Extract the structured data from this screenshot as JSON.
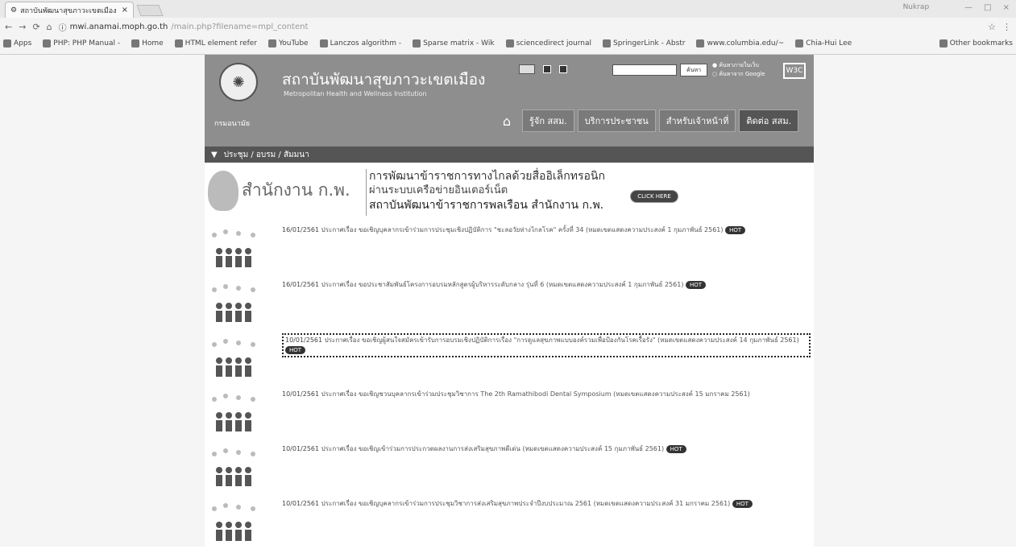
{
  "browser": {
    "tab_title": "สถาบันพัฒนาสุขภาวะเขตเมือง",
    "tab_close": "×",
    "user_label": "Nukrap",
    "window_controls": [
      "—",
      "□",
      "×"
    ],
    "url_host": "mwi.anamai.moph.go.th",
    "url_path": "/main.php?filename=mpl_content",
    "bookmarks": [
      "Apps",
      "PHP: PHP Manual -",
      "Home",
      "HTML element refer",
      "YouTube",
      "Lanczos algorithm -",
      "Sparse matrix - Wik",
      "sciencedirect journal",
      "SpringerLink - Abstr",
      "www.columbia.edu/~",
      "Chia-Hui Lee"
    ],
    "other_bookmarks": "Other bookmarks"
  },
  "site": {
    "title": "สถาบันพัฒนาสุขภาวะเขตเมือง",
    "subtitle": "Metropolitan Health and Wellness Institution",
    "dept": "กรมอนามัย",
    "search_button": "ค้นหา",
    "radio1": "ค้นหาภายในเว็บ",
    "radio2": "ค้นหาจาก Google",
    "w3c": "W3C",
    "nav": [
      "รู้จัก สสม.",
      "บริการประชาชน",
      "สำหรับเจ้าหน้าที่",
      "ติดต่อ สสม."
    ],
    "breadcrumb": "ประชุม / อบรม / สัมมนา",
    "banner_org": "สำนักงาน ก.พ.",
    "banner_line1": "การพัฒนาข้าราชการทางไกลด้วยสื่ออิเล็กทรอนิก",
    "banner_line2": "ผ่านระบบเครือข่ายอินเตอร์เน็ต",
    "banner_line3": "สถาบันพัฒนาข้าราชการพลเรือน สำนักงาน ก.พ.",
    "click_here": "CLICK HERE",
    "hot": "HOT"
  },
  "news": [
    {
      "date": "16/01/2561",
      "text": "ประกาศเรื่อง ขอเชิญบุคลากรเข้าร่วมการประชุมเชิงปฏิบัติการ \"ชะลอวัยห่างไกลโรค\" ครั้งที่ 34 (หมดเขตแสดงความประสงค์ 1 กุมภาพันธ์ 2561)"
    },
    {
      "date": "16/01/2561",
      "text": "ประกาศเรื่อง ขอประชาสัมพันธ์โครงการอบรมหลักสูตรผู้บริหารระดับกลาง รุ่นที่ 6 (หมดเขตแสดงความประสงค์ 1 กุมภาพันธ์ 2561)"
    },
    {
      "date": "10/01/2561",
      "text": "ประกาศเรื่อง ขอเชิญผู้สนใจสมัครเข้ารับการอบรมเชิงปฏิบัติการเรื่อง \"การดูแลสุขภาพแบบองค์รวมเพื่อป้องกันโรคเรื้อรัง\" (หมดเขตแสดงความประสงค์ 14 กุมภาพันธ์ 2561)"
    },
    {
      "date": "10/01/2561",
      "text": "ประกาศเรื่อง ขอเชิญชวนบุคลากรเข้าร่วมประชุมวิชาการ The 2th Ramathibodi Dental Symposium (หมดเขตแสดงความประสงค์ 15 มกราคม 2561)"
    },
    {
      "date": "10/01/2561",
      "text": "ประกาศเรื่อง ขอเชิญเข้าร่วมการประกวดผลงานการส่งเสริมสุขภาพดีเด่น (หมดเขตแสดงความประสงค์ 15 กุมภาพันธ์ 2561)"
    },
    {
      "date": "10/01/2561",
      "text": "ประกาศเรื่อง ขอเชิญบุคลากรเข้าร่วมการประชุมวิชาการส่งเสริมสุขภาพประจำปีงบประมาณ 2561 (หมดเขตแสดงความประสงค์ 31 มกราคม 2561)"
    }
  ]
}
